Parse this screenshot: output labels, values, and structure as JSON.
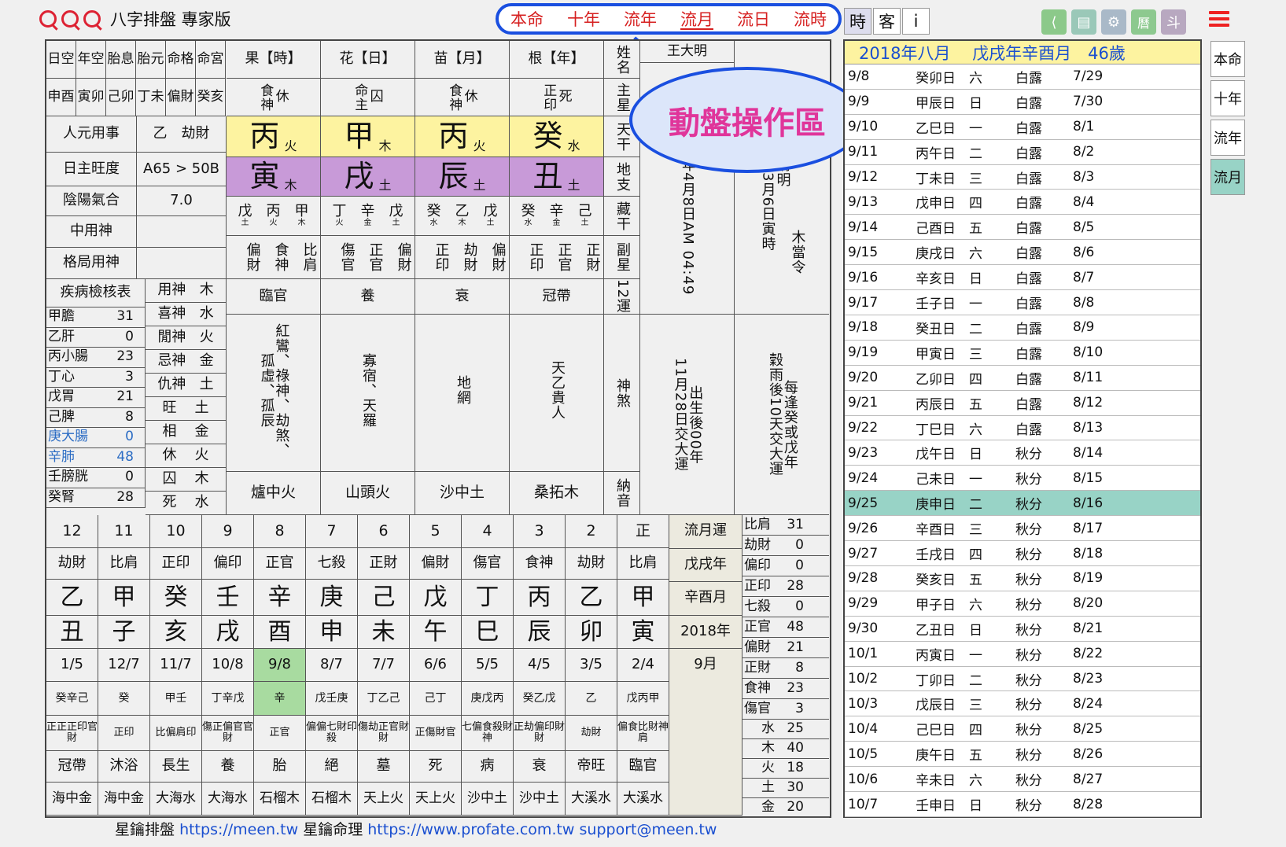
{
  "app": {
    "title": "八字排盤 專家版"
  },
  "nav": [
    "本命",
    "十年",
    "流年",
    "流月",
    "流日",
    "流時"
  ],
  "nav_active": 3,
  "modes": {
    "time": "時",
    "guest": "客",
    "info": "i"
  },
  "right_tabs": [
    "本命",
    "十年",
    "流年",
    "流月"
  ],
  "right_active": 3,
  "bubble": "動盤操作區",
  "kong": [
    [
      "日空",
      "申酉"
    ],
    [
      "年空",
      "寅卯"
    ],
    [
      "胎息",
      "己卯"
    ],
    [
      "胎元",
      "丁未"
    ],
    [
      "命格",
      "偏財"
    ],
    [
      "命宮",
      "癸亥"
    ]
  ],
  "pillars": [
    {
      "head": "果【時】",
      "star": "食神",
      "state": "休",
      "stem": "丙",
      "stem_el": "火",
      "branch": "寅",
      "branch_el": "木",
      "hidden": [
        [
          "戊",
          "土"
        ],
        [
          "丙",
          "火"
        ],
        [
          "甲",
          "木"
        ]
      ],
      "fu": [
        "偏財",
        "食神",
        "比肩"
      ],
      "yun": "臨官",
      "sha": "紅鸞、祿神、劫煞、孤虛、孤辰",
      "nayin": "爐中火"
    },
    {
      "head": "花【日】",
      "star": "命主",
      "state": "囚",
      "stem": "甲",
      "stem_el": "木",
      "branch": "戌",
      "branch_el": "土",
      "hidden": [
        [
          "丁",
          "火"
        ],
        [
          "辛",
          "金"
        ],
        [
          "戊",
          "土"
        ]
      ],
      "fu": [
        "傷官",
        "正官",
        "偏財"
      ],
      "yun": "養",
      "sha": "寡宿、天羅",
      "nayin": "山頭火"
    },
    {
      "head": "苗【月】",
      "star": "食神",
      "state": "休",
      "stem": "丙",
      "stem_el": "火",
      "branch": "辰",
      "branch_el": "土",
      "hidden": [
        [
          "癸",
          "水"
        ],
        [
          "乙",
          "木"
        ],
        [
          "戊",
          "土"
        ]
      ],
      "fu": [
        "正印",
        "劫財",
        "偏財"
      ],
      "yun": "衰",
      "sha": "地網",
      "nayin": "沙中土"
    },
    {
      "head": "根【年】",
      "star": "正印",
      "state": "死",
      "stem": "癸",
      "stem_el": "水",
      "branch": "丑",
      "branch_el": "土",
      "hidden": [
        [
          "癸",
          "水"
        ],
        [
          "辛",
          "金"
        ],
        [
          "己",
          "土"
        ]
      ],
      "fu": [
        "正印",
        "正官",
        "正財"
      ],
      "yun": "冠帶",
      "sha": "天乙貴人",
      "nayin": "桑拓木"
    }
  ],
  "rowlabels": [
    "姓名",
    "主星",
    "天干",
    "地支",
    "藏干",
    "副星",
    "12運",
    "神煞",
    "納音"
  ],
  "left": {
    "renyuan": [
      "人元用事",
      "乙　劫財"
    ],
    "wang": [
      "日主旺度",
      "A65 > 50B"
    ],
    "yinyang": [
      "陰陽氣合",
      "7.0"
    ],
    "zhong": [
      "中用神",
      ""
    ],
    "geju": [
      "格局用神",
      ""
    ],
    "jibing": "疾病檢核表"
  },
  "shen": [
    [
      "用神",
      "木"
    ],
    [
      "喜神",
      "水"
    ],
    [
      "閒神",
      "火"
    ],
    [
      "忌神",
      "金"
    ],
    [
      "仇神",
      "土"
    ]
  ],
  "wang5": [
    [
      "旺",
      "土"
    ],
    [
      "相",
      "金"
    ],
    [
      "休",
      "火"
    ],
    [
      "囚",
      "木"
    ],
    [
      "死",
      "水"
    ]
  ],
  "organs": [
    [
      "甲膽",
      "31"
    ],
    [
      "乙肝",
      "0"
    ],
    [
      "丙小腸",
      "23"
    ],
    [
      "丁心",
      "3"
    ],
    [
      "戊胃",
      "21"
    ],
    [
      "己脾",
      "8"
    ],
    [
      "庚大腸",
      "0"
    ],
    [
      "辛肺",
      "48"
    ],
    [
      "壬膀胱",
      "0"
    ],
    [
      "癸腎",
      "28"
    ]
  ],
  "birth": {
    "a": "王大明",
    "b": "年4月8日AM 04:49",
    "c": "年3月6日寅時",
    "d": "清明",
    "e": "木當令",
    "f": "11月28日交大運",
    "g": "出生後00年",
    "h": "穀雨後10天交大運",
    "i": "每逢癸或戊年"
  },
  "dayun": [
    {
      "n": "12",
      "g": "劫財",
      "s": "乙",
      "b": "丑",
      "d": "1/5",
      "h": "癸辛己",
      "f": "正正正印官財",
      "y": "冠帶",
      "ny": "海中金"
    },
    {
      "n": "11",
      "g": "比肩",
      "s": "甲",
      "b": "子",
      "d": "12/7",
      "h": "癸",
      "f": "正印",
      "y": "沐浴",
      "ny": "海中金"
    },
    {
      "n": "10",
      "g": "正印",
      "s": "癸",
      "b": "亥",
      "d": "11/7",
      "h": "甲壬",
      "f": "比偏肩印",
      "y": "長生",
      "ny": "大海水"
    },
    {
      "n": "9",
      "g": "偏印",
      "s": "壬",
      "b": "戌",
      "d": "10/8",
      "h": "丁辛戊",
      "f": "傷正偏官官財",
      "y": "養",
      "ny": "大海水"
    },
    {
      "n": "8",
      "g": "正官",
      "s": "辛",
      "b": "酉",
      "d": "9/8",
      "h": "辛",
      "f": "正官",
      "y": "胎",
      "ny": "石榴木"
    },
    {
      "n": "7",
      "g": "七殺",
      "s": "庚",
      "b": "申",
      "d": "8/7",
      "h": "戊壬庚",
      "f": "偏偏七財印殺",
      "y": "絕",
      "ny": "石榴木"
    },
    {
      "n": "6",
      "g": "正財",
      "s": "己",
      "b": "未",
      "d": "7/7",
      "h": "丁乙己",
      "f": "傷劫正官財財",
      "y": "墓",
      "ny": "天上火"
    },
    {
      "n": "5",
      "g": "偏財",
      "s": "戊",
      "b": "午",
      "d": "6/6",
      "h": "己丁",
      "f": "正傷財官",
      "y": "死",
      "ny": "天上火"
    },
    {
      "n": "4",
      "g": "傷官",
      "s": "丁",
      "b": "巳",
      "d": "5/5",
      "h": "庚戊丙",
      "f": "七偏食殺財神",
      "y": "病",
      "ny": "沙中土"
    },
    {
      "n": "3",
      "g": "食神",
      "s": "丙",
      "b": "辰",
      "d": "4/5",
      "h": "癸乙戊",
      "f": "正劫偏印財財",
      "y": "衰",
      "ny": "沙中土"
    },
    {
      "n": "2",
      "g": "劫財",
      "s": "乙",
      "b": "卯",
      "d": "3/5",
      "h": "乙",
      "f": "劫財",
      "y": "帝旺",
      "ny": "大溪水"
    },
    {
      "n": "正",
      "g": "比肩",
      "s": "甲",
      "b": "寅",
      "d": "2/4",
      "h": "戊丙甲",
      "f": "偏食比財神肩",
      "y": "臨官",
      "ny": "大溪水"
    }
  ],
  "dayun_active": 4,
  "liuyue": [
    "流月運",
    "戊戌年",
    "辛酉月",
    "2018年",
    "9月"
  ],
  "tengods": [
    [
      "比肩",
      "31"
    ],
    [
      "劫財",
      "0"
    ],
    [
      "偏印",
      "0"
    ],
    [
      "正印",
      "28"
    ],
    [
      "七殺",
      "0"
    ],
    [
      "正官",
      "48"
    ],
    [
      "偏財",
      "21"
    ],
    [
      "正財",
      "8"
    ],
    [
      "食神",
      "23"
    ],
    [
      "傷官",
      "3"
    ]
  ],
  "elements": [
    [
      "水",
      "25"
    ],
    [
      "木",
      "40"
    ],
    [
      "火",
      "18"
    ],
    [
      "土",
      "30"
    ],
    [
      "金",
      "20"
    ]
  ],
  "month": {
    "header": "2018年八月　 戊戌年辛酉月　46歲",
    "active": 17,
    "rows": [
      [
        "9/8",
        "癸卯日",
        "六",
        "白露",
        "7/29"
      ],
      [
        "9/9",
        "甲辰日",
        "日",
        "白露",
        "7/30"
      ],
      [
        "9/10",
        "乙巳日",
        "一",
        "白露",
        "8/1"
      ],
      [
        "9/11",
        "丙午日",
        "二",
        "白露",
        "8/2"
      ],
      [
        "9/12",
        "丁未日",
        "三",
        "白露",
        "8/3"
      ],
      [
        "9/13",
        "戊申日",
        "四",
        "白露",
        "8/4"
      ],
      [
        "9/14",
        "己酉日",
        "五",
        "白露",
        "8/5"
      ],
      [
        "9/15",
        "庚戌日",
        "六",
        "白露",
        "8/6"
      ],
      [
        "9/16",
        "辛亥日",
        "日",
        "白露",
        "8/7"
      ],
      [
        "9/17",
        "壬子日",
        "一",
        "白露",
        "8/8"
      ],
      [
        "9/18",
        "癸丑日",
        "二",
        "白露",
        "8/9"
      ],
      [
        "9/19",
        "甲寅日",
        "三",
        "白露",
        "8/10"
      ],
      [
        "9/20",
        "乙卯日",
        "四",
        "白露",
        "8/11"
      ],
      [
        "9/21",
        "丙辰日",
        "五",
        "白露",
        "8/12"
      ],
      [
        "9/22",
        "丁巳日",
        "六",
        "白露",
        "8/13"
      ],
      [
        "9/23",
        "戊午日",
        "日",
        "秋分",
        "8/14"
      ],
      [
        "9/24",
        "己未日",
        "一",
        "秋分",
        "8/15"
      ],
      [
        "9/25",
        "庚申日",
        "二",
        "秋分",
        "8/16"
      ],
      [
        "9/26",
        "辛酉日",
        "三",
        "秋分",
        "8/17"
      ],
      [
        "9/27",
        "壬戌日",
        "四",
        "秋分",
        "8/18"
      ],
      [
        "9/28",
        "癸亥日",
        "五",
        "秋分",
        "8/19"
      ],
      [
        "9/29",
        "甲子日",
        "六",
        "秋分",
        "8/20"
      ],
      [
        "9/30",
        "乙丑日",
        "日",
        "秋分",
        "8/21"
      ],
      [
        "10/1",
        "丙寅日",
        "一",
        "秋分",
        "8/22"
      ],
      [
        "10/2",
        "丁卯日",
        "二",
        "秋分",
        "8/23"
      ],
      [
        "10/3",
        "戊辰日",
        "三",
        "秋分",
        "8/24"
      ],
      [
        "10/4",
        "己巳日",
        "四",
        "秋分",
        "8/25"
      ],
      [
        "10/5",
        "庚午日",
        "五",
        "秋分",
        "8/26"
      ],
      [
        "10/6",
        "辛未日",
        "六",
        "秋分",
        "8/27"
      ],
      [
        "10/7",
        "壬申日",
        "日",
        "秋分",
        "8/28"
      ]
    ]
  },
  "footer": {
    "t1": "星鑰排盤",
    "l1": "https://meen.tw",
    "t2": "星鑰命理",
    "l2": "https://www.profate.com.tw",
    "l3": "support@meen.tw"
  },
  "colors": {
    "stem": "#fdf3a0",
    "branch": "#c89ad8",
    "active": "#98d3c6",
    "dayun_active": "#a8dba0",
    "nav": "#d62020",
    "link": "#1a4fd0"
  }
}
